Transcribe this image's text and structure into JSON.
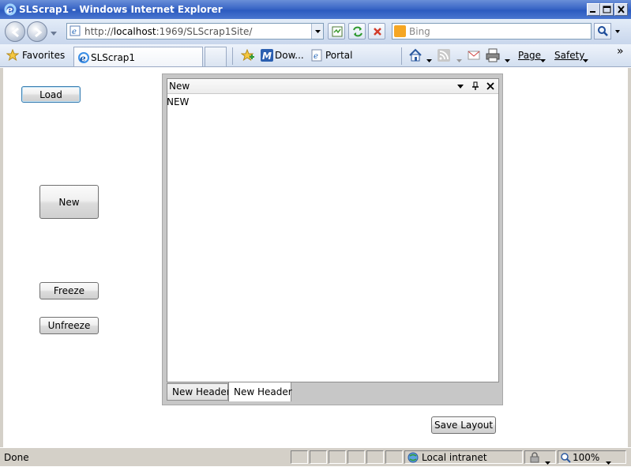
{
  "window": {
    "title": "SLScrap1 - Windows Internet Explorer"
  },
  "address_bar": {
    "url_prefix": "http://",
    "url_host": "localhost",
    "url_rest": ":1969/SLScrap1Site/"
  },
  "search": {
    "placeholder": "Bing"
  },
  "favorites_bar": {
    "favorites_label": "Favorites",
    "active_tab_label": "SLScrap1",
    "links": [
      {
        "label": "Dow..."
      },
      {
        "label": "Portal"
      }
    ],
    "commands": {
      "page_label": "Page",
      "safety_label": "Safety",
      "more_glyph": "»"
    }
  },
  "app": {
    "load_button": "Load",
    "new_button": "New",
    "freeze_button": "Freeze",
    "unfreeze_button": "Unfreeze",
    "save_layout_button": "Save Layout",
    "dock": {
      "header_title": "New",
      "content_text": "NEW",
      "tabs": [
        {
          "label": "New Header"
        },
        {
          "label": "New Header"
        }
      ]
    }
  },
  "status_bar": {
    "status": "Done",
    "zone": "Local intranet",
    "zoom": "100%"
  },
  "colors": {
    "title_bar": "#3b67c6",
    "chrome": "#d4d0c8",
    "accent_focus": "#3c7fb1"
  }
}
